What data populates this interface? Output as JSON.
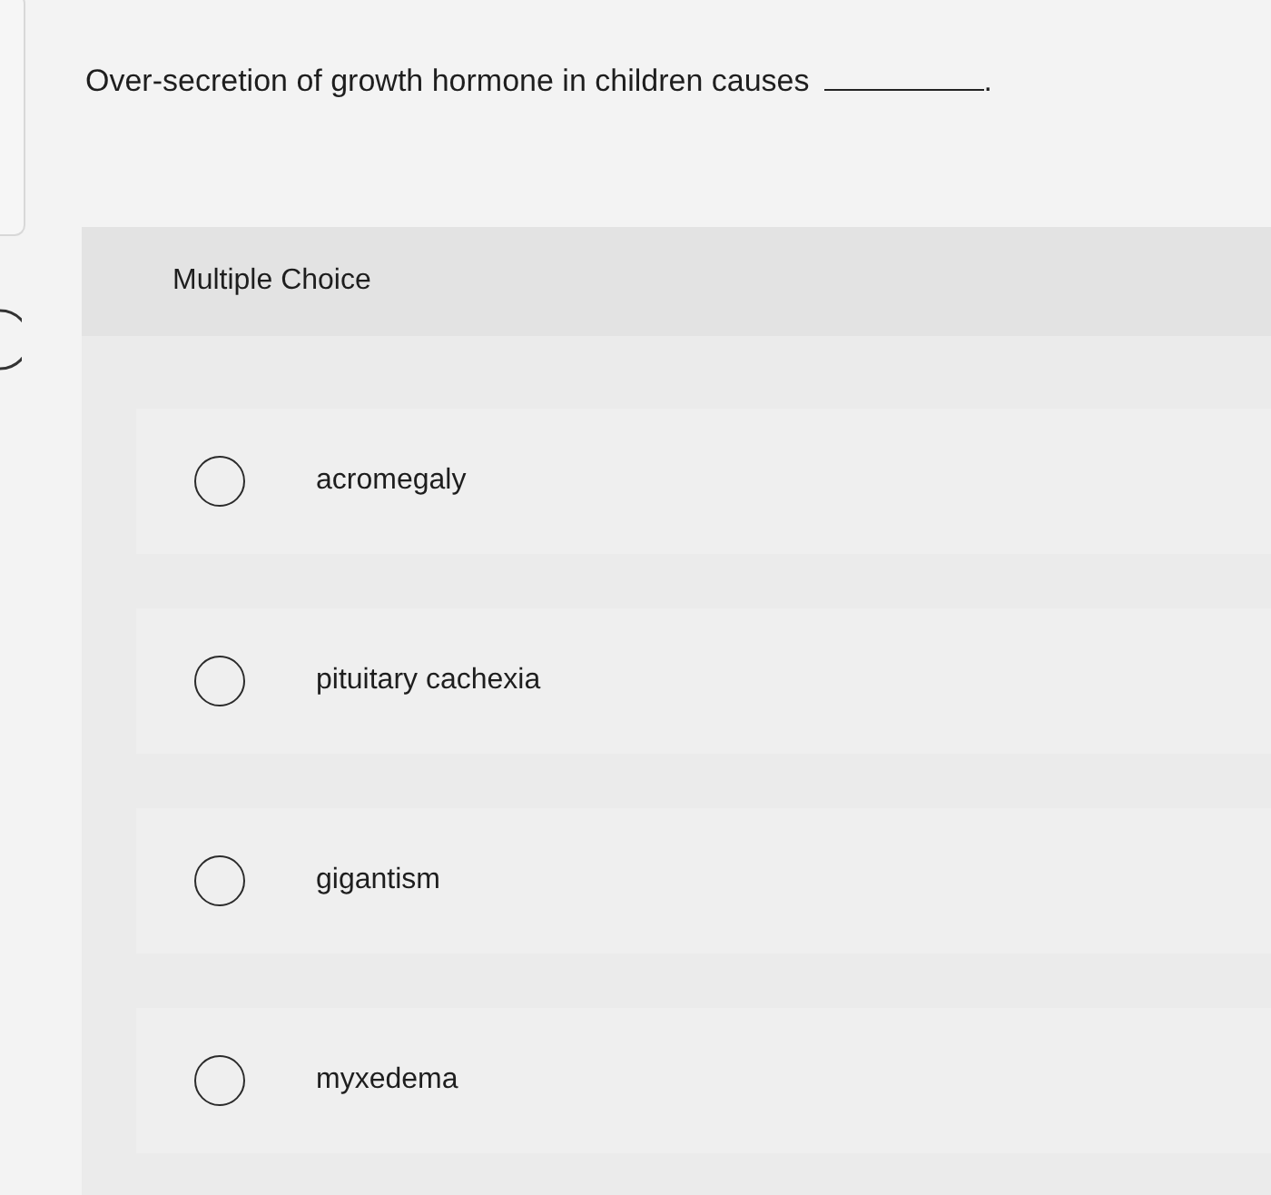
{
  "question": {
    "text": "Over-secretion of growth hormone in children causes",
    "end": "."
  },
  "answer_panel": {
    "title": "Multiple Choice",
    "options": [
      {
        "label": "acromegaly",
        "selected": false
      },
      {
        "label": "pituitary cachexia",
        "selected": false
      },
      {
        "label": "gigantism",
        "selected": false
      },
      {
        "label": "myxedema",
        "selected": false
      }
    ]
  }
}
